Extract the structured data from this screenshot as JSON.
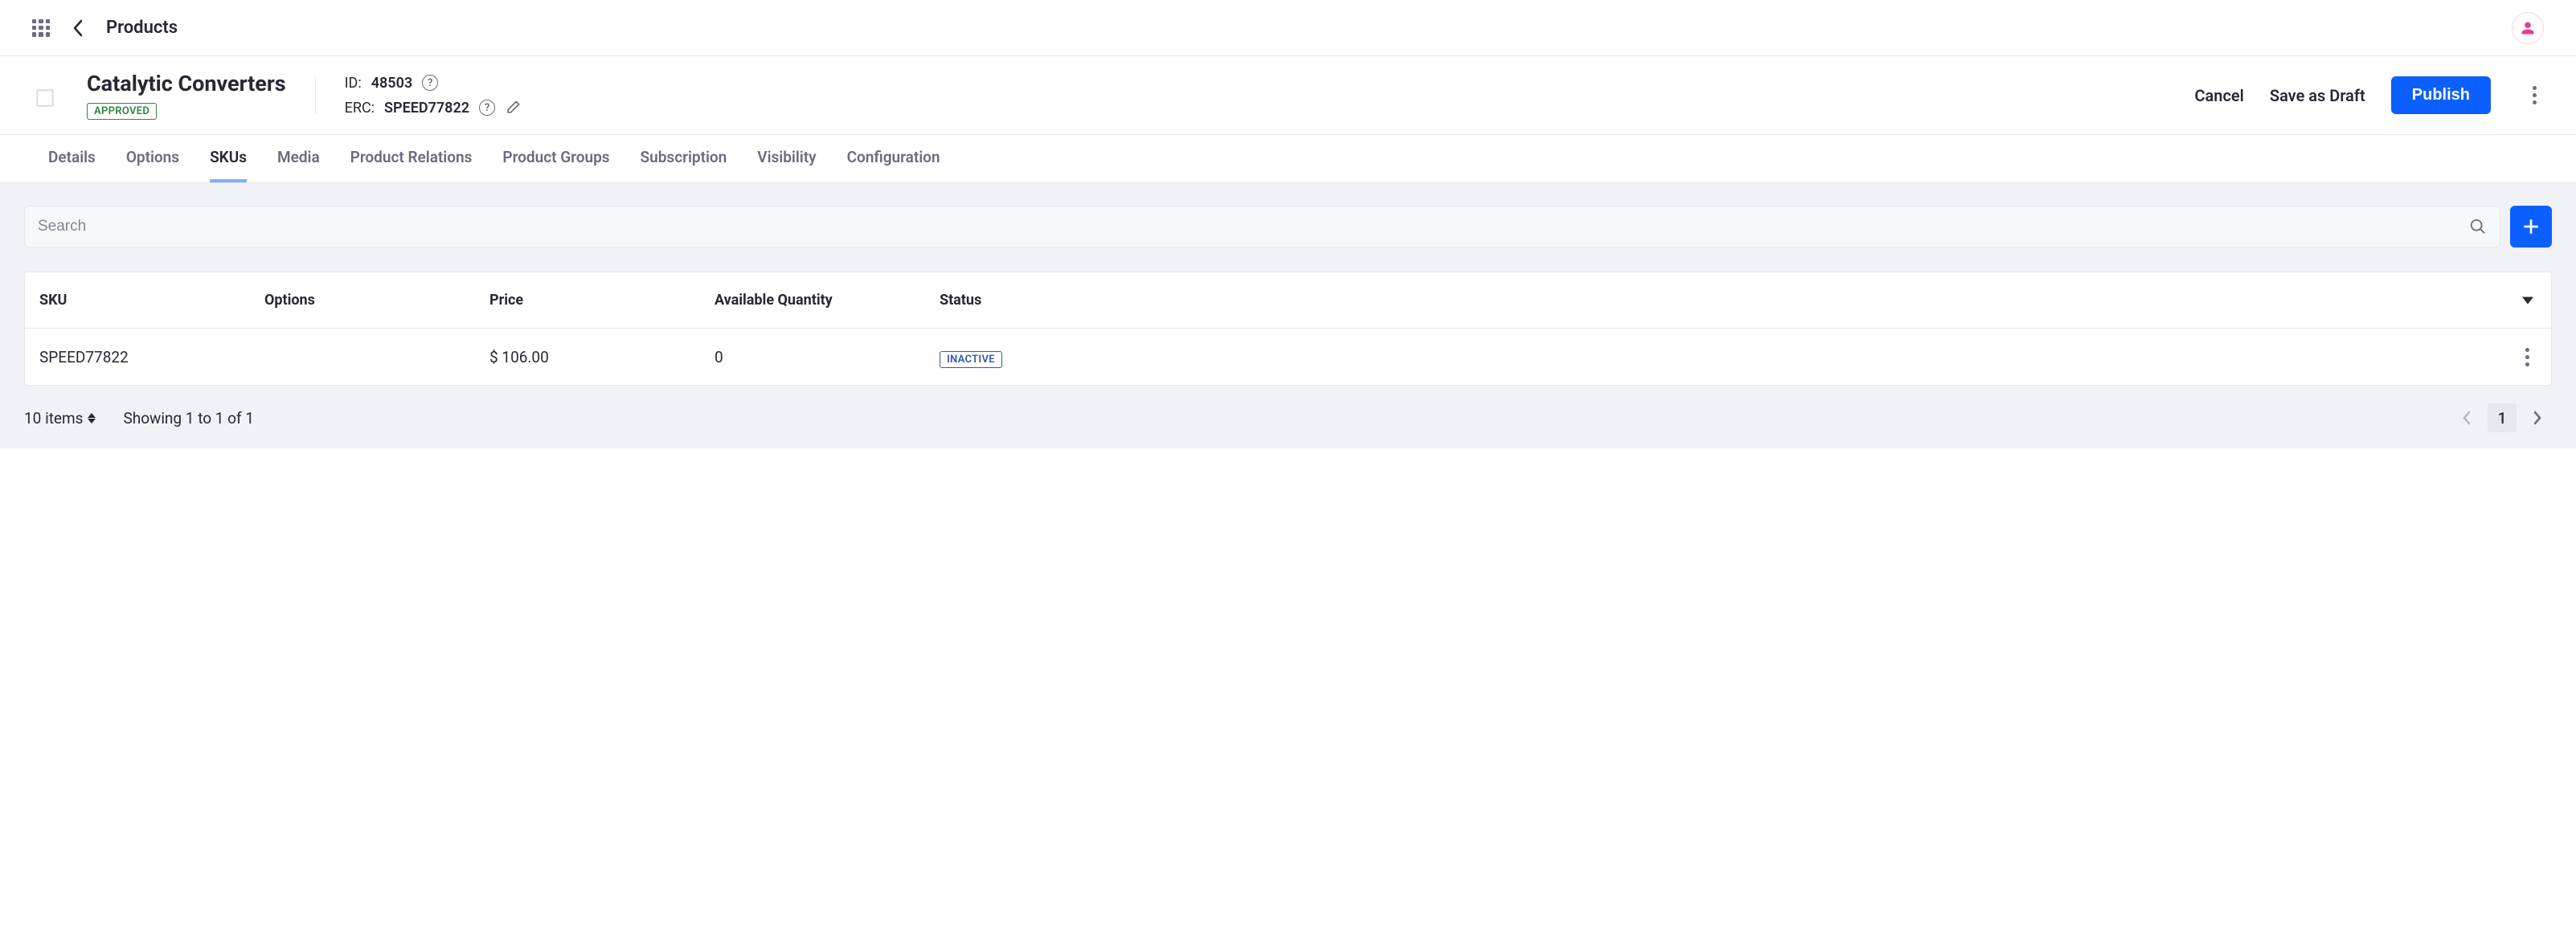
{
  "topbar": {
    "breadcrumb": "Products"
  },
  "product": {
    "name": "Catalytic Converters",
    "approved_label": "APPROVED",
    "id_label": "ID:",
    "id_value": "48503",
    "erc_label": "ERC:",
    "erc_value": "SPEED77822"
  },
  "actions": {
    "cancel": "Cancel",
    "save_draft": "Save as Draft",
    "publish": "Publish"
  },
  "tabs": [
    {
      "label": "Details"
    },
    {
      "label": "Options"
    },
    {
      "label": "SKUs"
    },
    {
      "label": "Media"
    },
    {
      "label": "Product Relations"
    },
    {
      "label": "Product Groups"
    },
    {
      "label": "Subscription"
    },
    {
      "label": "Visibility"
    },
    {
      "label": "Configuration"
    }
  ],
  "active_tab_index": 2,
  "search": {
    "placeholder": "Search"
  },
  "table": {
    "columns": {
      "sku": "SKU",
      "options": "Options",
      "price": "Price",
      "qty": "Available Quantity",
      "status": "Status"
    },
    "rows": [
      {
        "sku": "SPEED77822",
        "options": "",
        "price": "$ 106.00",
        "qty": "0",
        "status": "INACTIVE"
      }
    ]
  },
  "footer": {
    "items_label": "10 items",
    "showing": "Showing 1 to 1 of 1",
    "page": "1"
  }
}
